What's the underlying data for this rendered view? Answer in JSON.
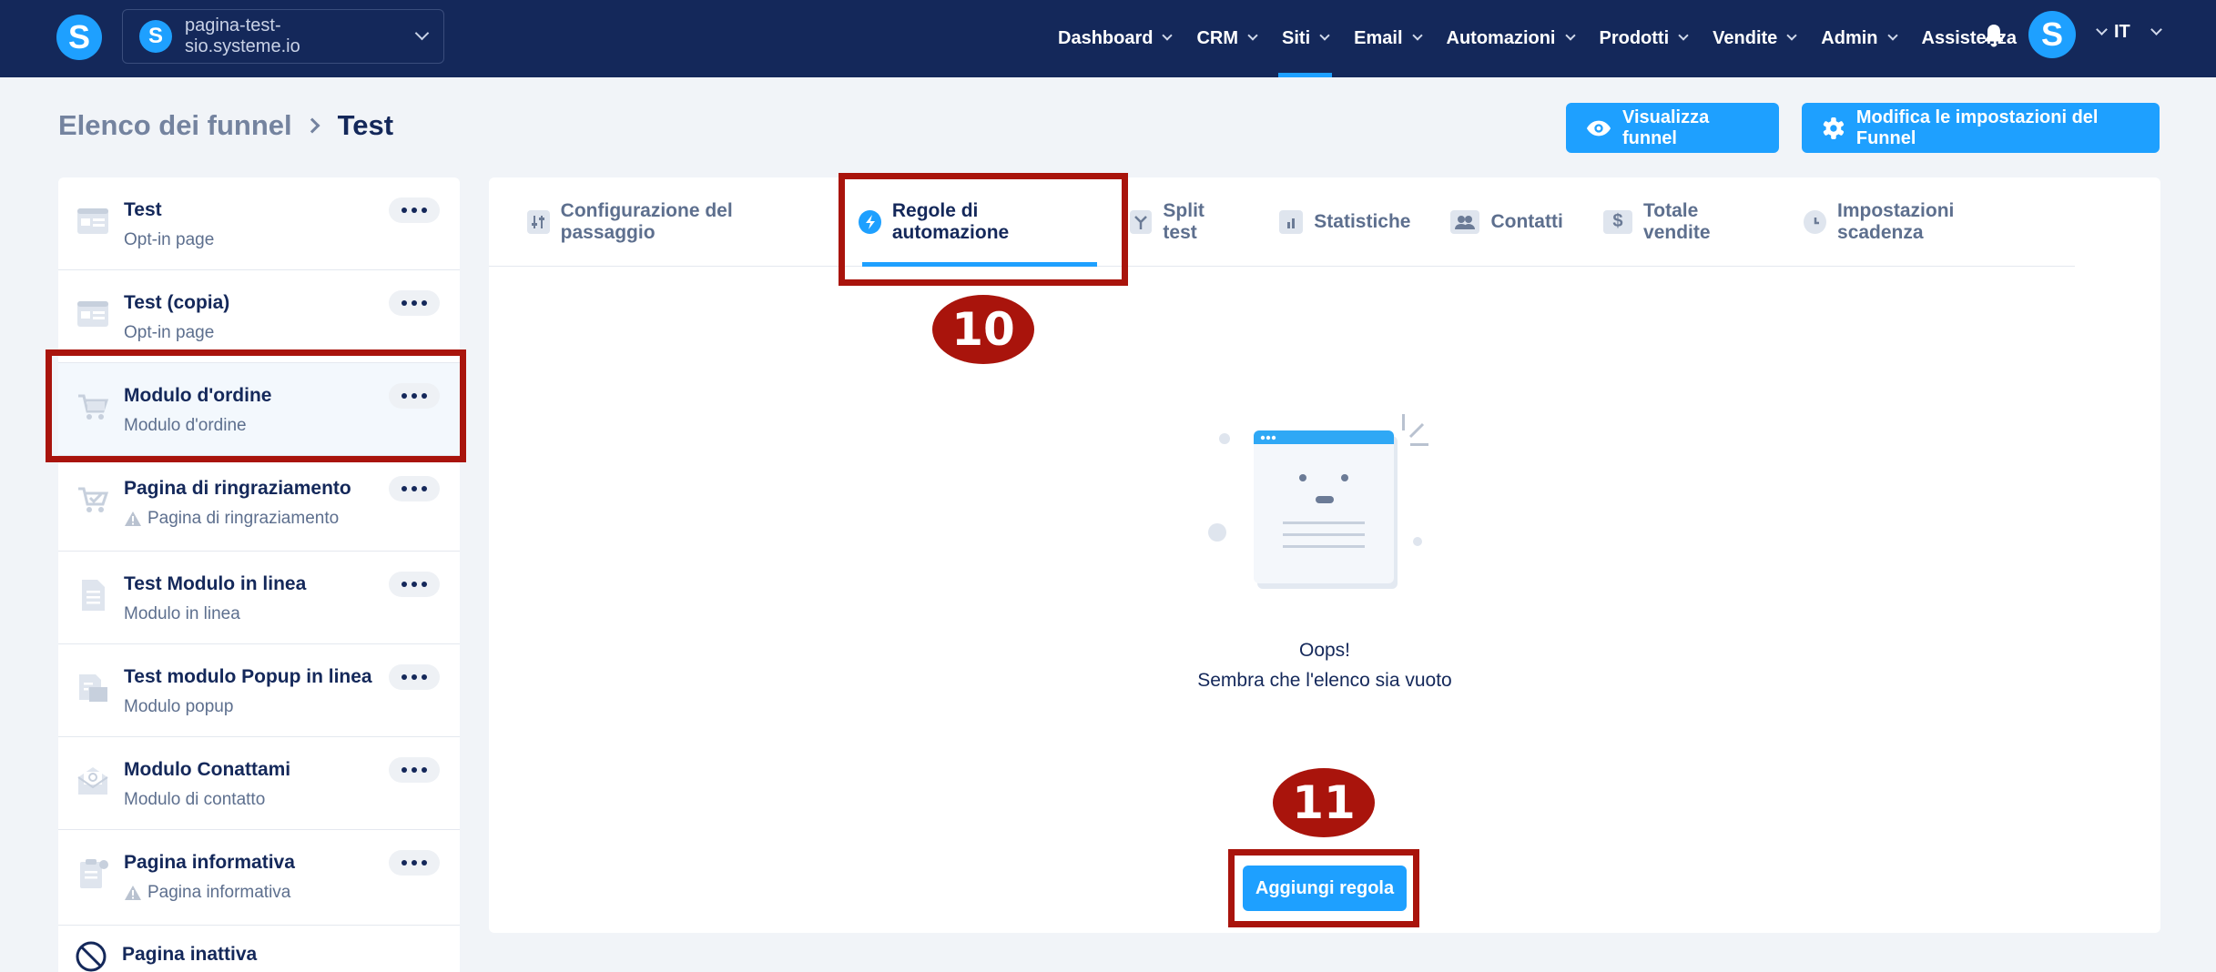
{
  "navbar": {
    "logo": "S",
    "site": {
      "logo": "S",
      "label": "pagina-test-sio.systeme.io"
    },
    "menu": [
      {
        "label": "Dashboard",
        "dropdown": true
      },
      {
        "label": "CRM",
        "dropdown": true
      },
      {
        "label": "Siti",
        "dropdown": true,
        "active": true
      },
      {
        "label": "Email",
        "dropdown": true
      },
      {
        "label": "Automazioni",
        "dropdown": true
      },
      {
        "label": "Prodotti",
        "dropdown": true
      },
      {
        "label": "Vendite",
        "dropdown": true
      },
      {
        "label": "Admin",
        "dropdown": true
      },
      {
        "label": "Assistenza",
        "dropdown": false
      }
    ],
    "avatar": "S",
    "language": "IT"
  },
  "header": {
    "breadcrumb_parent": "Elenco dei funnel",
    "breadcrumb_current": "Test",
    "view_button": "Visualizza funnel",
    "settings_button": "Modifica le impostazioni del Funnel"
  },
  "sidebar": {
    "steps": [
      {
        "title": "Test",
        "subtitle": "Opt-in page",
        "icon": "optin-page-icon",
        "warning": false
      },
      {
        "title": "Test (copia)",
        "subtitle": "Opt-in page",
        "icon": "optin-page-icon",
        "warning": false
      },
      {
        "title": "Modulo d'ordine",
        "subtitle": "Modulo d'ordine",
        "icon": "cart-icon",
        "warning": false,
        "selected": true
      },
      {
        "title": "Pagina di ringraziamento",
        "subtitle": "Pagina di ringraziamento",
        "icon": "cart-check-icon",
        "warning": true
      },
      {
        "title": "Test Modulo in linea",
        "subtitle": "Modulo in linea",
        "icon": "document-icon",
        "warning": false
      },
      {
        "title": "Test modulo Popup in linea",
        "subtitle": "Modulo popup",
        "icon": "popup-icon",
        "warning": false
      },
      {
        "title": "Modulo Conattami",
        "subtitle": "Modulo di contatto",
        "icon": "contact-mail-icon",
        "warning": false
      },
      {
        "title": "Pagina informativa",
        "subtitle": "Pagina informativa",
        "icon": "info-page-icon",
        "warning": true
      },
      {
        "title": "Pagina inattiva",
        "subtitle": "",
        "icon": "inactive-icon",
        "warning": false
      }
    ]
  },
  "tabs": [
    {
      "label": "Configurazione del passaggio",
      "icon": "sliders-icon"
    },
    {
      "label": "Regole di automazione",
      "icon": "lightning-icon",
      "active": true
    },
    {
      "label": "Split test",
      "icon": "split-icon"
    },
    {
      "label": "Statistiche",
      "icon": "bar-chart-icon"
    },
    {
      "label": "Contatti",
      "icon": "users-icon"
    },
    {
      "label": "Totale vendite",
      "icon": "dollar-icon"
    },
    {
      "label": "Impostazioni scadenza",
      "icon": "clock-icon"
    }
  ],
  "empty_state": {
    "title": "Oops!",
    "message": "Sembra che l'elenco sia vuoto",
    "add_button": "Aggiungi regola"
  },
  "annotations": {
    "badge_1": "10",
    "badge_2": "11",
    "color": "#a9140c"
  },
  "colors": {
    "navbar": "#14285a",
    "accent": "#1ea0ff",
    "background": "#f1f4f8"
  }
}
